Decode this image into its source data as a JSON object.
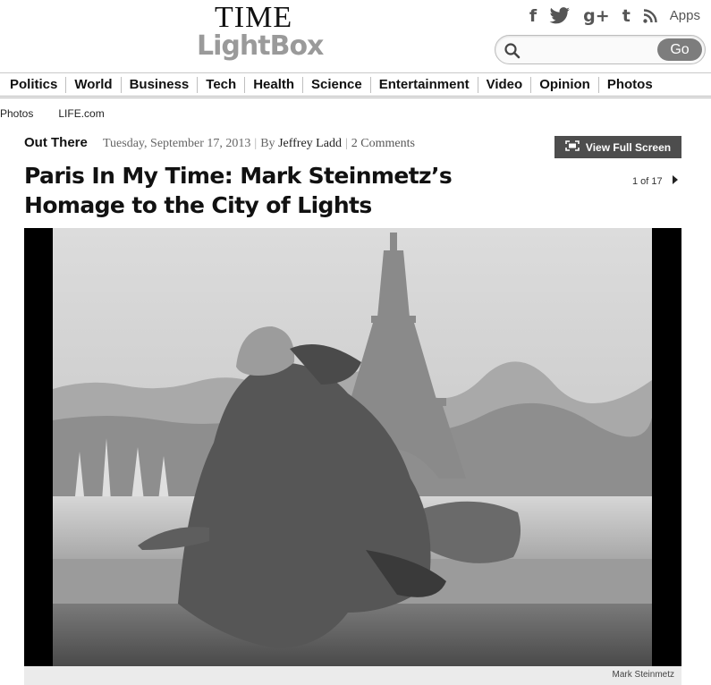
{
  "header": {
    "logo_top": "TIME",
    "logo_bottom": "LightBox",
    "social": {
      "facebook": "f",
      "twitter_icon": "twitter-bird-icon",
      "google_plus": "g+",
      "tumblr": "t",
      "rss_icon": "rss-icon",
      "apps": "Apps"
    },
    "search": {
      "placeholder": "",
      "value": "",
      "go_label": "Go"
    }
  },
  "nav": {
    "items": [
      "Politics",
      "World",
      "Business",
      "Tech",
      "Health",
      "Science",
      "Entertainment",
      "Video",
      "Opinion",
      "Photos"
    ]
  },
  "subnav": {
    "items": [
      "Photos",
      "LIFE.com"
    ]
  },
  "article": {
    "section": "Out There",
    "date": "Tuesday, September 17, 2013",
    "by_prefix": "By",
    "author": "Jeffrey Ladd",
    "comments": "2 Comments",
    "fullscreen_label": "View Full Screen",
    "headline": "Paris In My Time: Mark Steinmetz’s Homage to the City of Lights",
    "pager": "1 of 17",
    "photo_credit": "Mark Steinmetz"
  }
}
